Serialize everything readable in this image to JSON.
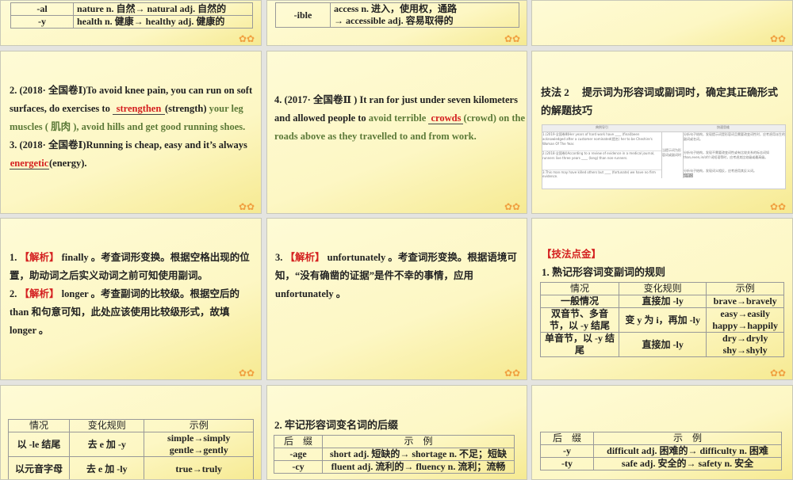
{
  "slides": {
    "s0a": {
      "rows": [
        {
          "suffix": "-al",
          "example": "nature n. 自然→ natural adj. 自然的"
        },
        {
          "suffix": "-y",
          "example": "health n. 健康→ healthy adj. 健康的"
        }
      ]
    },
    "s0b": {
      "suffix": "-ible",
      "line1": "access n. 进入，使用权，通路",
      "line2": "→ accessible adj. 容易取得的"
    },
    "s1a": {
      "q2_pre": "2. (2018· 全国卷Ⅰ)To avoid knee pain, you can run on soft surfaces, do exercises to ",
      "q2_ans": "strengthen",
      "q2_hint": "(strength)",
      "q2_post": " your leg muscles ( 肌肉 ), avoid hills and get good running shoes.",
      "q3_pre": "3. (2018· 全国卷Ⅰ)Running is cheap, easy and it’s always ",
      "q3_ans": "energetic",
      "q3_hint": "(energy)."
    },
    "s1b": {
      "pre": "4. (2017· 全国卷Ⅱ ) It ran for just under seven kilometers and allowed people to ",
      "green1": "avoid terrible ",
      "ans": "crowds",
      "green2": "(crowd) on the roads above as they travelled to and from work."
    },
    "s1c": {
      "title": "技法 2　 提示词为形容词或副词时，确定其正确形式的解题技巧",
      "col1": "典例导引",
      "col2": "快速思维",
      "mid": "当提示词为形容词或副词时",
      "rows": [
        "1.(2019·全国卷Ⅲ)Her years of hard work have ____ (final)been acknowledged after a customer nominated(提名) her to be Cheshire's Woman Of The Year.",
        "2.(2018·全国卷Ⅰ)According to a review of evidence in a medical journal, runners live three years ____ (long) than non-runners.",
        "3.This man may have killed others but ____ (fortunate) we have no firm evidence."
      ],
      "tips": [
        "分析句子结构，发现提示词是形容词且需要改变词性时，应考虑用派生的副词或名词。",
        "分析句子结构，发现不需要改变词性或有比较关系的标志词如than,even,in/of介词短语等时，应考虑其比较级或最高级。",
        "分析句子结构，发现词义相反，应考虑用其反义词。"
      ],
      "tag": "必考点"
    },
    "s2a": {
      "n1": "1. ",
      "tag": "【解析】",
      "a1": " finally 。考查词形变换。根据空格出现的位置，助动词之后实义动词之前可知使用副词。",
      "n2": "2. ",
      "a2": " longer 。考查副词的比较级。根据空后的than 和句意可知，此处应该使用比较级形式，故填longer 。"
    },
    "s2b": {
      "n3": "3. ",
      "tag": "【解析】",
      "a3": " unfortunately 。考查词形变换。根据语境可知，“没有确凿的证据”是件不幸的事情，应用unfortunately 。"
    },
    "s2c": {
      "heading": "【技法点金】",
      "sub": "1. 熟记形容词变副词的规则",
      "headers": [
        "情况",
        "变化规则",
        "示例"
      ],
      "rows": [
        [
          "一般情况",
          "直接加 -ly",
          "brave→bravely"
        ],
        [
          "双音节、多音节，以 -y 结尾",
          "变 y 为 i，再加 -ly",
          "easy→easily\nhappy→happily"
        ],
        [
          "单音节，以 -y 结尾",
          "直接加 -ly",
          "dry→dryly\nshy→shyly"
        ]
      ]
    },
    "s3a": {
      "headers": [
        "情况",
        "变化规则",
        "示例"
      ],
      "rows": [
        [
          "以 -le 结尾",
          "去 e 加 -y",
          "simple→simply\ngentle→gently"
        ],
        [
          "以元音字母",
          "去 e 加 -ly",
          "true→truly"
        ]
      ]
    },
    "s3b": {
      "sub": "2. 牢记形容词变名词的后缀",
      "headers": [
        "后　缀",
        "示　例"
      ],
      "rows": [
        [
          "-age",
          "short adj. 短缺的→ shortage n. 不足；短缺"
        ],
        [
          "-cy",
          "fluent adj. 流利的→ fluency n. 流利；流畅"
        ]
      ]
    },
    "s3c": {
      "headers": [
        "后　缀",
        "示　例"
      ],
      "rows": [
        [
          "-y",
          "difficult adj. 困难的→ difficulty n. 困难"
        ],
        [
          "-ty",
          "safe adj. 安全的→ safety n. 安全"
        ]
      ]
    }
  },
  "colors": {
    "green": "#5c7a38",
    "red": "#d42020"
  }
}
